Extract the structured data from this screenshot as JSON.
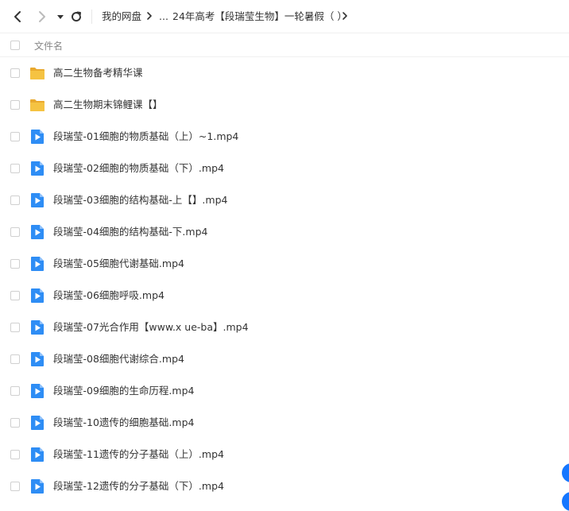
{
  "toolbar": {
    "back_icon": "chevron-left-icon",
    "forward_icon": "chevron-right-icon",
    "dropdown_icon": "caret-down-icon",
    "refresh_icon": "refresh-icon",
    "breadcrumb": {
      "root": "我的网盘",
      "ellipsis": "...",
      "current": "24年高考【段瑞莹生物】一轮暑假（ ）"
    }
  },
  "header": {
    "column_name": "文件名"
  },
  "files": [
    {
      "type": "folder",
      "name": "高二生物备考精华课"
    },
    {
      "type": "folder",
      "name": "高二生物期末锦鲤课【】"
    },
    {
      "type": "video",
      "name": "段瑞莹-01细胞的物质基础（上）~1.mp4"
    },
    {
      "type": "video",
      "name": "段瑞莹-02细胞的物质基础（下）.mp4"
    },
    {
      "type": "video",
      "name": "段瑞莹-03细胞的结构基础-上【】.mp4"
    },
    {
      "type": "video",
      "name": "段瑞莹-04细胞的结构基础-下.mp4"
    },
    {
      "type": "video",
      "name": "段瑞莹-05细胞代谢基础.mp4"
    },
    {
      "type": "video",
      "name": "段瑞莹-06细胞呼吸.mp4"
    },
    {
      "type": "video",
      "name": "段瑞莹-07光合作用【www.x ue-ba】.mp4"
    },
    {
      "type": "video",
      "name": "段瑞莹-08细胞代谢综合.mp4"
    },
    {
      "type": "video",
      "name": "段瑞莹-09细胞的生命历程.mp4"
    },
    {
      "type": "video",
      "name": "段瑞莹-10遗传的细胞基础.mp4"
    },
    {
      "type": "video",
      "name": "段瑞莹-11遗传的分子基础（上）.mp4"
    },
    {
      "type": "video",
      "name": "段瑞莹-12遗传的分子基础（下）.mp4"
    }
  ],
  "colors": {
    "folder": "#f5c342",
    "video": "#2e8df5",
    "accent": "#1677ff"
  }
}
